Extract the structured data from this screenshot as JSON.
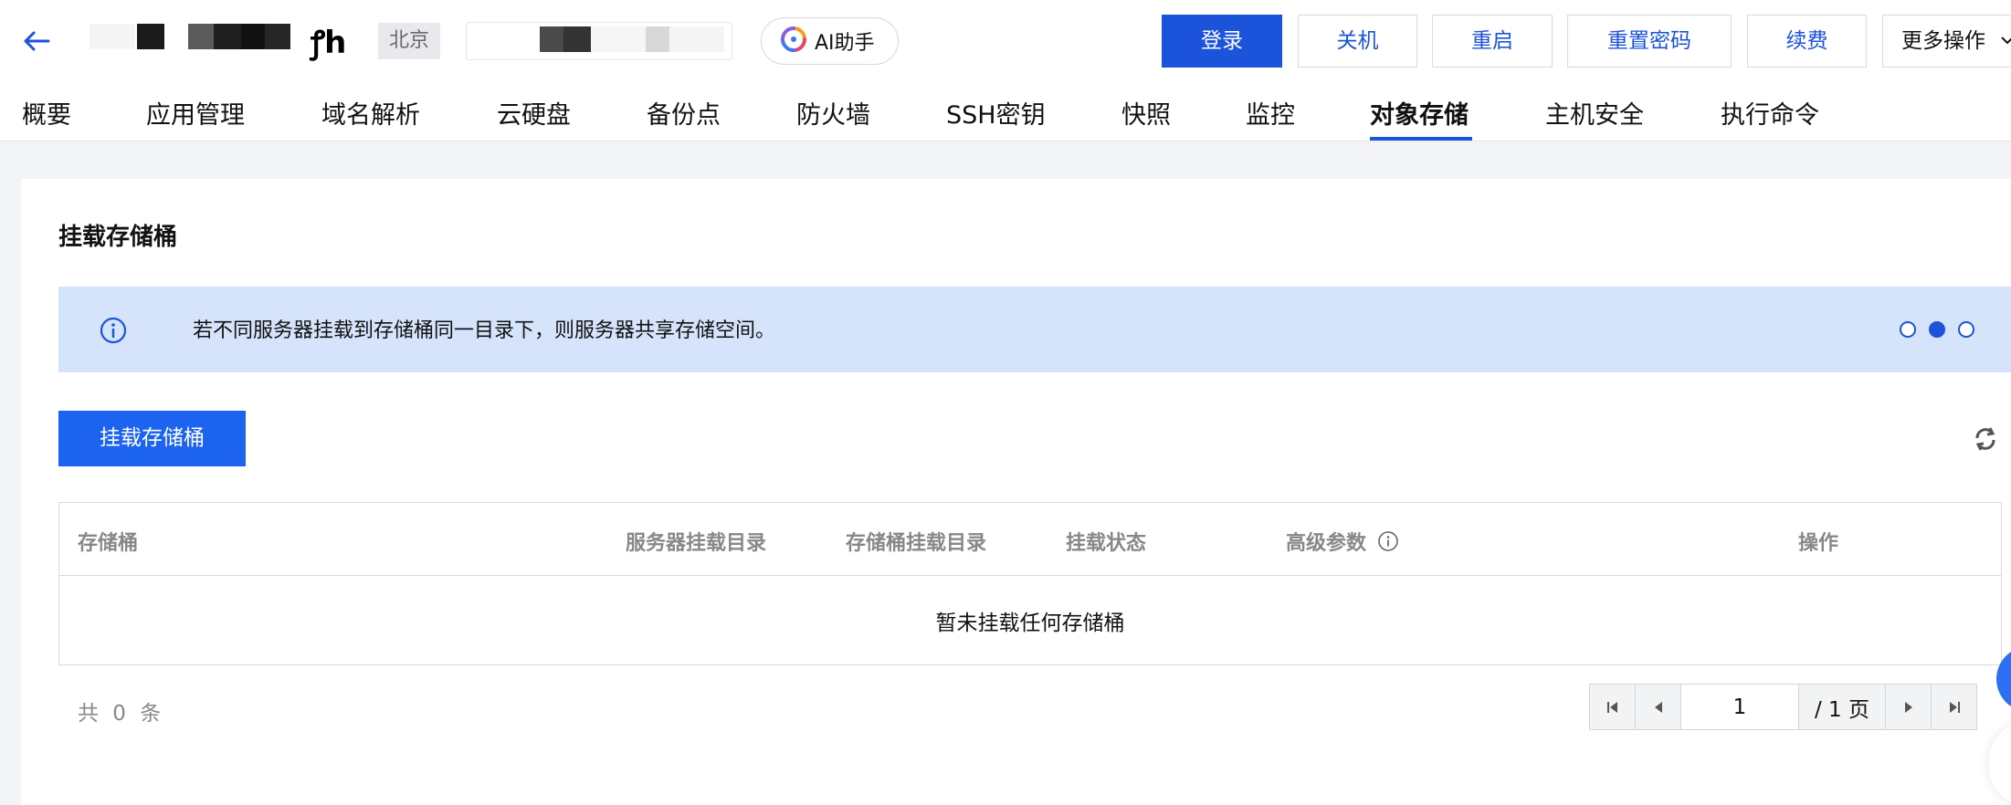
{
  "header": {
    "instance_suffix": "h",
    "region": "北京",
    "ai_assistant": "AI助手"
  },
  "actions": {
    "login": "登录",
    "shutdown": "关机",
    "restart": "重启",
    "reset_password": "重置密码",
    "renew": "续费",
    "more": "更多操作"
  },
  "tabs": [
    "概要",
    "应用管理",
    "域名解析",
    "云硬盘",
    "备份点",
    "防火墙",
    "SSH密钥",
    "快照",
    "监控",
    "对象存储",
    "主机安全",
    "执行命令"
  ],
  "active_tab": "对象存储",
  "section": {
    "title": "挂载存储桶",
    "notice": "若不同服务器挂载到存储桶同一目录下，则服务器共享存储空间。",
    "notice_page": "2 of 3",
    "mount_button": "挂载存储桶"
  },
  "table": {
    "columns": [
      "存储桶",
      "服务器挂载目录",
      "存储桶挂载目录",
      "挂载状态",
      "高级参数",
      "操作"
    ],
    "empty_text": "暂未挂载任何存储桶"
  },
  "pagination": {
    "total": "共 0 条",
    "current_page": "1",
    "total_pages": "/ 1 页"
  },
  "colors": {
    "primary": "#1c53db",
    "notice_bg": "#d6e4fb"
  }
}
